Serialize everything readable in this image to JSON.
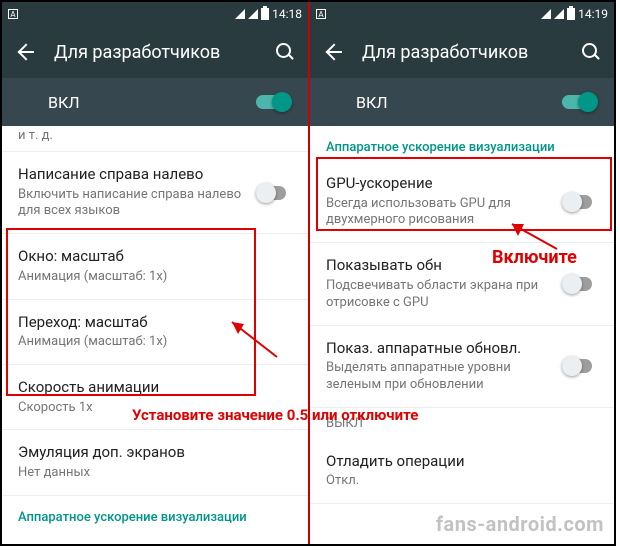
{
  "left": {
    "status": {
      "time": "14:18"
    },
    "appbar": {
      "title": "Для разработчиков"
    },
    "toggle": {
      "label": "ВКЛ"
    },
    "truncated": "и т. д.",
    "items": [
      {
        "title": "Написание справа налево",
        "sub": "Включить написание справа налево для всех языков",
        "switch": true
      },
      {
        "title": "Окно: масштаб",
        "sub": "Анимация (масштаб: 1x)"
      },
      {
        "title": "Переход: масштаб",
        "sub": "Анимация (масштаб: 1x)"
      },
      {
        "title": "Скорость анимации",
        "sub": "Скорость 1x"
      },
      {
        "title": "Эмуляция доп. экранов",
        "sub": "Нет данных"
      }
    ],
    "section": "Аппаратное ускорение визуализации"
  },
  "right": {
    "status": {
      "time": "14:19"
    },
    "appbar": {
      "title": "Для разработчиков"
    },
    "toggle": {
      "label": "ВКЛ"
    },
    "section": "Аппаратное ускорение визуализации",
    "items": [
      {
        "title": "GPU-ускорение",
        "sub": "Всегда использовать GPU для двухмерного рисования",
        "switch": true
      },
      {
        "title": "Показывать обн",
        "sub": "Подсвечивать области экрана при отрисовке с GPU",
        "switch": true
      },
      {
        "title": "Показ. аппаратные обновл.",
        "sub": "Выделять аппаратные уровни зеленым при обновлении",
        "switch": true
      },
      {
        "title": "ВЫКЛ",
        "sub": ""
      },
      {
        "title": "Отладить операции",
        "sub": "Откл."
      }
    ]
  },
  "annotations": {
    "bottom": "Установите значение 0.5 или отключите",
    "right": "Включите"
  },
  "watermark": "fans-android.com"
}
